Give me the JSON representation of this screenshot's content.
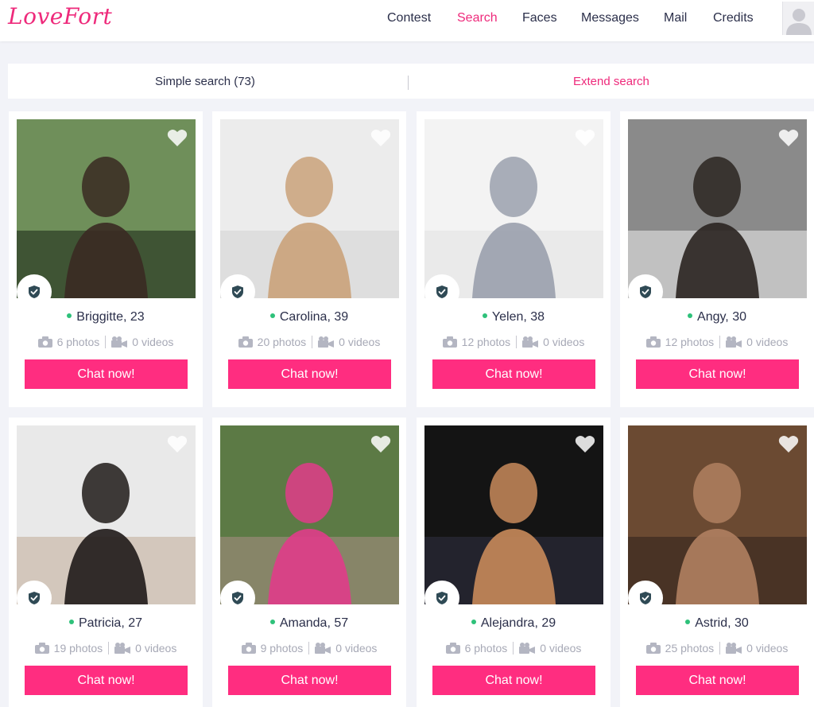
{
  "brand": {
    "logo": "LoveFort",
    "accent": "#ee2a7b"
  },
  "nav": {
    "items": [
      {
        "label": "Contest",
        "active": false
      },
      {
        "label": "Search",
        "active": true
      },
      {
        "label": "Faces",
        "active": false
      },
      {
        "label": "Messages",
        "active": false
      },
      {
        "label": "Mail",
        "active": false
      },
      {
        "label": "Credits",
        "active": false
      }
    ],
    "avatar_icon": "user-silhouette-icon"
  },
  "search": {
    "simple_label": "Simple search (73)",
    "extend_label": "Extend search"
  },
  "profiles": [
    {
      "name": "Briggitte, 23",
      "photos": "6 photos",
      "videos": "0 videos",
      "button": "Chat now!"
    },
    {
      "name": "Carolina, 39",
      "photos": "20 photos",
      "videos": "0 videos",
      "button": "Chat now!"
    },
    {
      "name": "Yelen, 38",
      "photos": "12 photos",
      "videos": "0 videos",
      "button": "Chat now!"
    },
    {
      "name": "Angy, 30",
      "photos": "12 photos",
      "videos": "0 videos",
      "button": "Chat now!"
    },
    {
      "name": "Patricia, 27",
      "photos": "19 photos",
      "videos": "0 videos",
      "button": "Chat now!"
    },
    {
      "name": "Amanda, 57",
      "photos": "9 photos",
      "videos": "0 videos",
      "button": "Chat now!"
    },
    {
      "name": "Alejandra, 29",
      "photos": "6 photos",
      "videos": "0 videos",
      "button": "Chat now!"
    },
    {
      "name": "Astrid, 30",
      "photos": "25 photos",
      "videos": "0 videos",
      "button": "Chat now!"
    }
  ],
  "colors": {
    "online": "#2ec17a",
    "button": "#ff2d80",
    "text": "#2b2f4a",
    "muted": "#a7a9b6",
    "background": "#f2f3f8"
  }
}
